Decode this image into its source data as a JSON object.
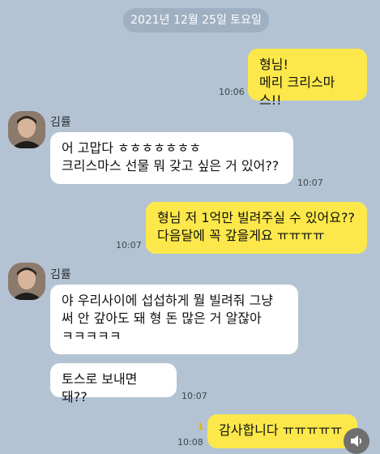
{
  "date_separator": "2021년 12월 25일 토요일",
  "messages": [
    {
      "text": "형님!\n메리 크리스마스!!",
      "time": "10:06"
    },
    {
      "sender": "김률",
      "text": "어 고맙다 ㅎㅎㅎㅎㅎㅎㅎ\n크리스마스 선물 뭐 갖고 싶은 거 있어??",
      "time": "10:07"
    },
    {
      "text": "형님 저 1억만 빌려주실 수 있어요??\n다음달에 꼭 갚을게요 ㅠㅠㅠㅠ",
      "time": "10:07"
    },
    {
      "sender": "김률",
      "text": "야 우리사이에 섭섭하게 뭘 빌려줘  그냥\n써 안 갚아도 돼    형 돈 많은 거 알잖아\nㅋㅋㅋㅋㅋ",
      "time": ""
    },
    {
      "text": "토스로 보내면 돼??",
      "time": "10:07"
    },
    {
      "text": "감사합니다 ㅠㅠㅠㅠㅠ",
      "time": "10:08",
      "unread": "1"
    }
  ],
  "icons": {
    "avatar": "profile-photo",
    "sound": "speaker-icon"
  }
}
